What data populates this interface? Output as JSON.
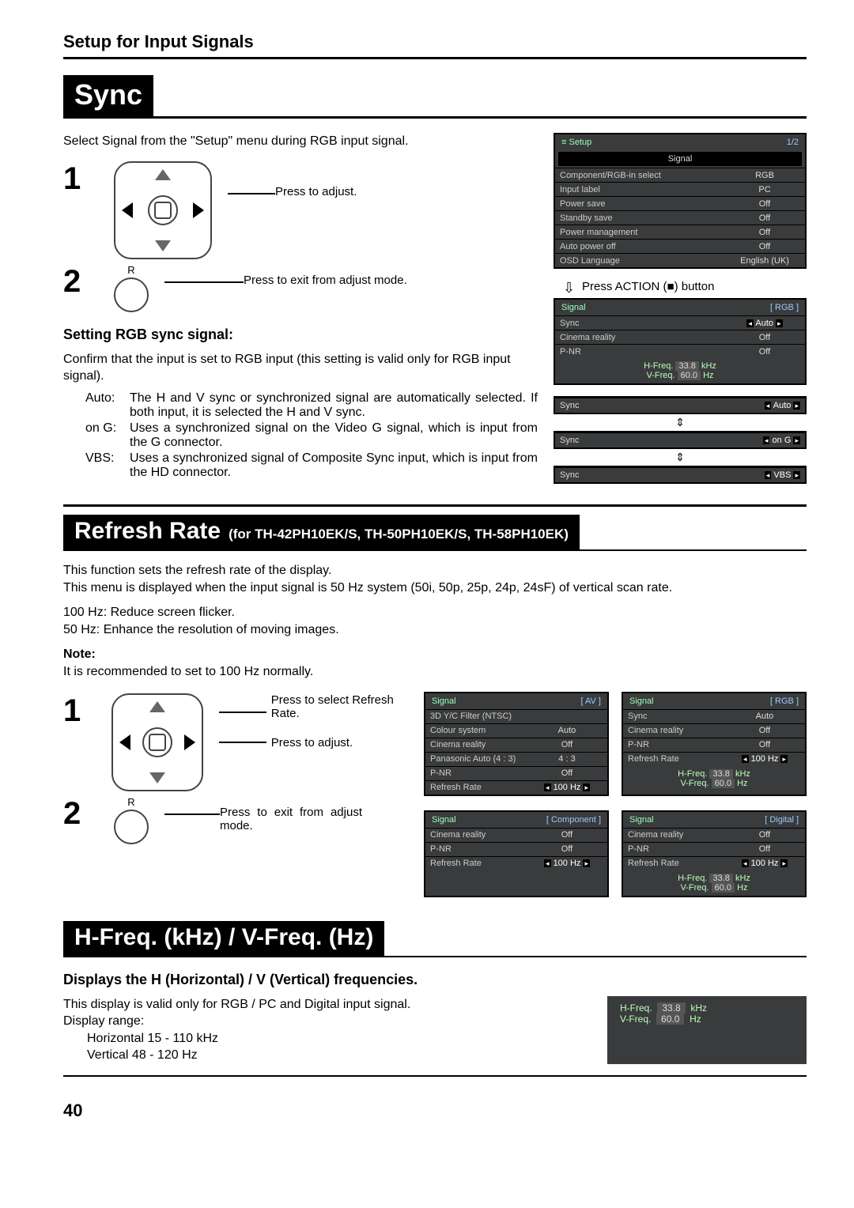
{
  "section_header": "Setup for Input Signals",
  "sync": {
    "title": "Sync",
    "intro": "Select Signal from the \"Setup\" menu during RGB input signal.",
    "step1_caption": "Press to adjust.",
    "step2_label": "R",
    "step2_caption": "Press to exit from adjust mode.",
    "sub_heading": "Setting RGB sync signal:",
    "confirm_text": "Confirm that the input is set to RGB input (this setting is valid only for RGB input signal).",
    "defs": [
      {
        "k": "Auto:",
        "v": "The H and V sync or synchronized signal are automatically selected. If both input, it is selected the H and V sync."
      },
      {
        "k": "on G:",
        "v": "Uses a synchronized signal on the Video G signal, which is input from the G connector."
      },
      {
        "k": "VBS:",
        "v": "Uses a synchronized signal of Composite Sync input, which is input from the HD connector."
      }
    ],
    "press_action": "Press ACTION (■) button",
    "setup_osd": {
      "title": "Setup",
      "page": "1/2",
      "signal_strip": "Signal",
      "rows": [
        {
          "label": "Component/RGB-in select",
          "value": "RGB"
        },
        {
          "label": "Input label",
          "value": "PC"
        },
        {
          "label": "Power save",
          "value": "Off"
        },
        {
          "label": "Standby save",
          "value": "Off"
        },
        {
          "label": "Power management",
          "value": "Off"
        },
        {
          "label": "Auto power off",
          "value": "Off"
        },
        {
          "label": "OSD Language",
          "value": "English (UK)"
        }
      ]
    },
    "signal_osd": {
      "title": "Signal",
      "tag": "[ RGB ]",
      "rows": [
        {
          "label": "Sync",
          "value": "Auto",
          "ctl": true
        },
        {
          "label": "Cinema reality",
          "value": "Off"
        },
        {
          "label": "P-NR",
          "value": "Off"
        }
      ],
      "hfreq_label": "H-Freq.",
      "hfreq_val": "33.8",
      "hfreq_unit": "kHz",
      "vfreq_label": "V-Freq.",
      "vfreq_val": "60.0",
      "vfreq_unit": "Hz"
    },
    "sync_states": [
      {
        "label": "Sync",
        "value": "Auto"
      },
      {
        "label": "Sync",
        "value": "on G"
      },
      {
        "label": "Sync",
        "value": "VBS"
      }
    ]
  },
  "refresh": {
    "title_big": "Refresh Rate",
    "title_small": "(for TH-42PH10EK/S, TH-50PH10EK/S, TH-58PH10EK)",
    "p1": "This function sets the refresh rate of the display.",
    "p2": "This menu is displayed when the input signal is 50 Hz system (50i, 50p, 25p, 24p, 24sF) of vertical scan rate.",
    "p3": "100 Hz: Reduce screen flicker.",
    "p4": "50 Hz: Enhance the resolution of moving images.",
    "note_label": "Note:",
    "note_text": "It is recommended to set to 100 Hz normally.",
    "step1_cap1": "Press to select Refresh Rate.",
    "step1_cap2": "Press to adjust.",
    "step2_label": "R",
    "step2_caption": "Press to exit from adjust mode.",
    "osd_av": {
      "title": "Signal",
      "tag": "[ AV ]",
      "rows": [
        {
          "label": "3D Y/C Filter (NTSC)",
          "value": ""
        },
        {
          "label": "Colour system",
          "value": "Auto"
        },
        {
          "label": "Cinema reality",
          "value": "Off"
        },
        {
          "label": "Panasonic Auto (4 : 3)",
          "value": "4 : 3"
        },
        {
          "label": "P-NR",
          "value": "Off"
        },
        {
          "label": "Refresh Rate",
          "value": "100 Hz",
          "ctl": true
        }
      ]
    },
    "osd_component": {
      "title": "Signal",
      "tag": "[ Component ]",
      "rows": [
        {
          "label": "Cinema reality",
          "value": "Off"
        },
        {
          "label": "P-NR",
          "value": "Off"
        },
        {
          "label": "Refresh Rate",
          "value": "100 Hz",
          "ctl": true
        }
      ]
    },
    "osd_rgb": {
      "title": "Signal",
      "tag": "[ RGB ]",
      "rows": [
        {
          "label": "Sync",
          "value": "Auto"
        },
        {
          "label": "Cinema reality",
          "value": "Off"
        },
        {
          "label": "P-NR",
          "value": "Off"
        },
        {
          "label": "Refresh Rate",
          "value": "100 Hz",
          "ctl": true
        }
      ],
      "hfreq_label": "H-Freq.",
      "hfreq_val": "33.8",
      "hfreq_unit": "kHz",
      "vfreq_label": "V-Freq.",
      "vfreq_val": "60.0",
      "vfreq_unit": "Hz"
    },
    "osd_digital": {
      "title": "Signal",
      "tag": "[ Digital ]",
      "rows": [
        {
          "label": "Cinema reality",
          "value": "Off"
        },
        {
          "label": "P-NR",
          "value": "Off"
        },
        {
          "label": "Refresh Rate",
          "value": "100 Hz",
          "ctl": true
        }
      ],
      "hfreq_label": "H-Freq.",
      "hfreq_val": "33.8",
      "hfreq_unit": "kHz",
      "vfreq_label": "V-Freq.",
      "vfreq_val": "60.0",
      "vfreq_unit": "Hz"
    }
  },
  "hfreq": {
    "title": "H-Freq. (kHz) / V-Freq. (Hz)",
    "sub": "Displays the H (Horizontal) / V (Vertical) frequencies.",
    "p1": "This display is valid only for RGB / PC and Digital input signal.",
    "p2": "Display range:",
    "p3": "Horizontal 15 - 110 kHz",
    "p4": "Vertical 48 - 120 Hz",
    "box": {
      "hfreq_label": "H-Freq.",
      "hfreq_val": "33.8",
      "hfreq_unit": "kHz",
      "vfreq_label": "V-Freq.",
      "vfreq_val": "60.0",
      "vfreq_unit": "Hz"
    }
  },
  "page_number": "40"
}
